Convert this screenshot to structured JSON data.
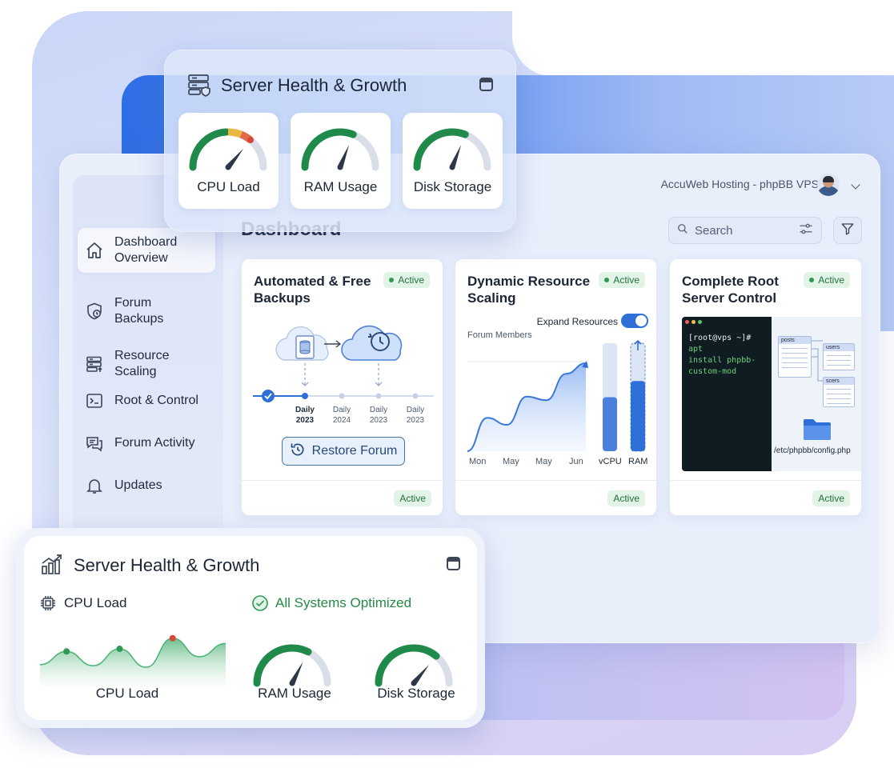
{
  "brand": {
    "accent": "#2f6fd8",
    "active_green": "#2e9a55",
    "gauge_green": "#1f8a4a"
  },
  "top_panel": {
    "title": "Server Health & Growth",
    "gauges": [
      {
        "label": "CPU Load",
        "value": 0.72
      },
      {
        "label": "RAM Usage",
        "value": 0.62
      },
      {
        "label": "Disk Storage",
        "value": 0.62
      }
    ]
  },
  "header": {
    "host": "AccuWeb Hosting - phpBB VPS",
    "page_title": "Dashboard",
    "search_placeholder": "Search"
  },
  "sidebar": {
    "items": [
      {
        "label": "Dashboard Overview",
        "icon": "home-icon",
        "active": true
      },
      {
        "label": "Forum Backups",
        "icon": "shield-clock-icon"
      },
      {
        "label": "Resource Scaling",
        "icon": "server-rack-icon"
      },
      {
        "label": "Root & Control",
        "icon": "terminal-icon"
      },
      {
        "label": "Forum Activity",
        "icon": "chat-bubbles-icon"
      },
      {
        "label": "Updates",
        "icon": "bell-icon"
      }
    ]
  },
  "cards": {
    "backups": {
      "title": "Automated & Free Backups",
      "status": "Active",
      "footer_status": "Active",
      "timeline": [
        {
          "line1": "Daily",
          "line2": "2023"
        },
        {
          "line1": "Daily",
          "line2": "2024"
        },
        {
          "line1": "Daily",
          "line2": "2023"
        },
        {
          "line1": "Daily",
          "line2": "2023"
        }
      ],
      "restore_label": "Restore Forum"
    },
    "scaling": {
      "title": "Dynamic Resource Scaling",
      "status": "Active",
      "footer_status": "Active",
      "expand_label": "Expand Resources",
      "expand_enabled": true,
      "chart_title": "Forum Members",
      "x_labels": [
        "Mon",
        "May",
        "May",
        "Jun"
      ],
      "bar_labels": [
        "vCPU",
        "RAM"
      ]
    },
    "root": {
      "title": "Complete Root Server Control",
      "status": "Active",
      "footer_status": "Active",
      "terminal_line1": "[root@vps ~]#",
      "terminal_cmd1": "apt",
      "terminal_cmd2": "install phpbb-",
      "terminal_cmd3": "custom-mod",
      "tables": [
        "posts",
        "users",
        "scers"
      ],
      "path": "/etc/phpbb/config.php"
    }
  },
  "bottom_panel": {
    "title": "Server Health & Growth",
    "cpu_heading": "CPU Load",
    "optimized": "All Systems Optimized",
    "labels": [
      "CPU Load",
      "RAM Usage",
      "Disk Storage"
    ],
    "gauges": [
      {
        "label": "RAM Usage",
        "value": 0.65
      },
      {
        "label": "Disk Storage",
        "value": 0.72
      }
    ]
  },
  "chart_data": [
    {
      "type": "area",
      "title": "Forum Members",
      "x": [
        "Mon",
        "May",
        "May",
        "Jun"
      ],
      "series": [
        {
          "values": [
            0,
            38,
            30,
            62,
            58,
            88,
            100
          ]
        }
      ]
    },
    {
      "type": "bar",
      "categories": [
        "vCPU",
        "RAM"
      ],
      "series": [
        {
          "values": [
            50,
            65
          ]
        }
      ],
      "ylim": [
        0,
        100
      ]
    },
    {
      "type": "area",
      "title": "CPU Load",
      "series": [
        {
          "values": [
            20,
            45,
            18,
            50,
            15,
            70,
            35,
            60
          ]
        }
      ]
    }
  ]
}
